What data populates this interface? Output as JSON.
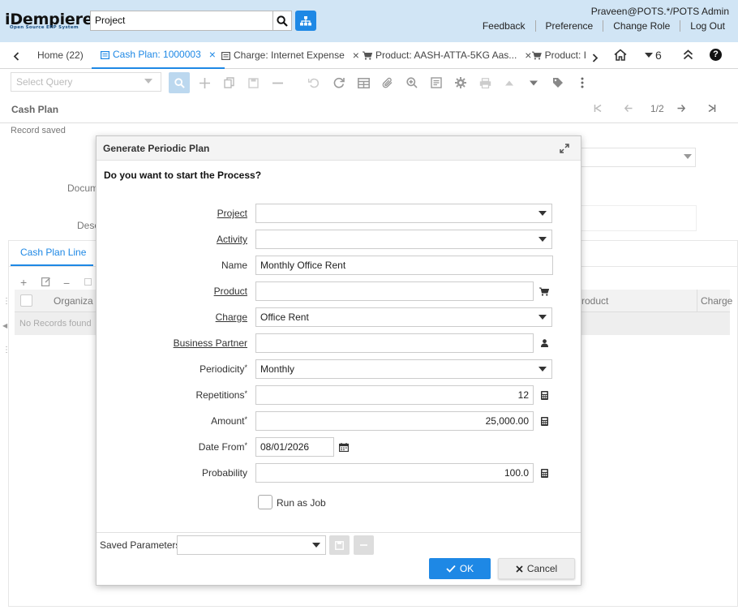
{
  "header": {
    "logo_text": "iDempiere",
    "logo_subtext": "Open Source ERP System",
    "search_value": "Project",
    "user": "Praveen@POTS.*/POTS Admin",
    "links": [
      "Feedback",
      "Preference",
      "Change Role",
      "Log Out"
    ]
  },
  "tabs": {
    "items": [
      {
        "label": "Home (22)"
      },
      {
        "label": "Cash Plan: 1000003"
      },
      {
        "label": "Charge: Internet Expense"
      },
      {
        "label": "Product: AASH-ATTA-5KG Aas..."
      },
      {
        "label": "Product: I"
      }
    ],
    "tab_count": "6"
  },
  "toolbar": {
    "select_query_placeholder": "Select Query"
  },
  "window": {
    "title": "Cash Plan",
    "status": "Record saved",
    "record_nav": "1/2",
    "field_label_doc": "Docum",
    "field_label_desc": "Desc",
    "detail_tab": "Cash Plan Line",
    "grid_col_org": "Organiza",
    "grid_col_product": "roduct",
    "grid_col_charge": "Charge",
    "grid_empty": "No Records found"
  },
  "dialog": {
    "title": "Generate Periodic Plan",
    "question": "Do you want to start the Process?",
    "fields": {
      "project": {
        "label": "Project",
        "value": ""
      },
      "activity": {
        "label": "Activity",
        "value": ""
      },
      "name": {
        "label": "Name",
        "value": "Monthly Office Rent"
      },
      "product": {
        "label": "Product",
        "value": ""
      },
      "charge": {
        "label": "Charge",
        "value": "Office Rent"
      },
      "bpartner": {
        "label": "Business Partner",
        "value": ""
      },
      "periodicity": {
        "label": "Periodicity",
        "value": "Monthly"
      },
      "repetitions": {
        "label": "Repetitions",
        "value": "12"
      },
      "amount": {
        "label": "Amount",
        "value": "25,000.00"
      },
      "date_from": {
        "label": "Date From",
        "value": "08/01/2026"
      },
      "probability": {
        "label": "Probability",
        "value": "100.0"
      }
    },
    "required_mark": "*",
    "run_as_job": "Run as Job",
    "saved_parameters": "Saved Parameters",
    "ok": "OK",
    "cancel": "Cancel"
  },
  "colors": {
    "accent": "#1e88e5",
    "header_bg": "#d1e5f5"
  }
}
